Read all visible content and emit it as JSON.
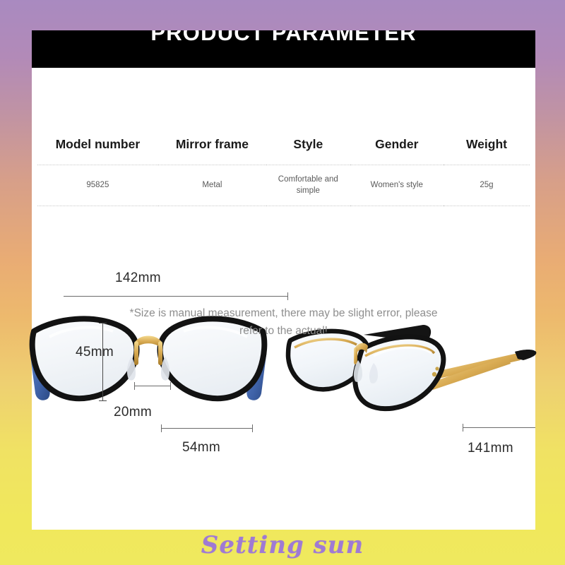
{
  "banner": {
    "title": "PRODUCT PARAMETER"
  },
  "spec_table": {
    "headers": [
      "Model number",
      "Mirror frame",
      "Style",
      "Gender",
      "Weight"
    ],
    "rows": [
      [
        "95825",
        "Metal",
        "Comfortable and simple",
        "Women's style",
        "25g"
      ]
    ]
  },
  "dimensions": {
    "front_width": "142mm",
    "lens_height": "45mm",
    "bridge_width": "20mm",
    "lens_width": "54mm",
    "temple_length": "141mm"
  },
  "footnote": {
    "line1": "*Size is manual measurement, there may be slight error, please",
    "line2": "refer to the actual!"
  },
  "watermark": {
    "text": "Setting sun"
  },
  "colors": {
    "banner_bg": "#000000",
    "card_bg": "#ffffff",
    "frame_black": "#111111",
    "frame_gold": "#d9ab53",
    "temple_blue": "#3f62a8",
    "watermark_purple": "#9f7ad4",
    "gradient_top": "#a98ac0",
    "gradient_mid": "#e9ac74",
    "gradient_bottom": "#f0e85c"
  }
}
